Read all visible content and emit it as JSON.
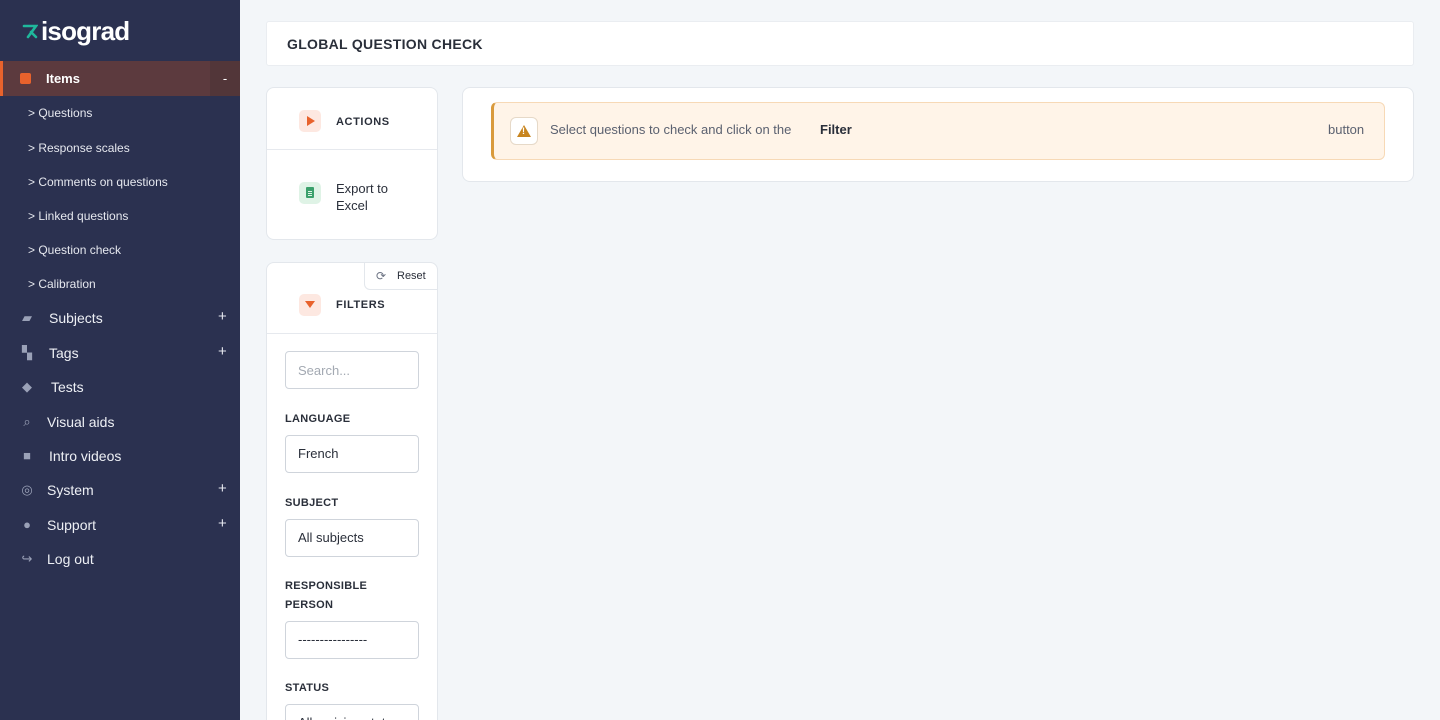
{
  "brand": {
    "name": "isograd",
    "accent": "#e8622c",
    "logo_color": "#1fb89c"
  },
  "sidebar": {
    "active_item": {
      "label": "Items",
      "icon": "pencil-square-icon",
      "toggle": "-"
    },
    "sub_items": [
      "> Questions",
      "> Response scales",
      "> Comments on questions",
      "> Linked questions",
      "> Question check",
      "> Calibration"
    ],
    "items": [
      {
        "label": "Subjects",
        "icon": "folder-icon",
        "expand": "+"
      },
      {
        "label": "Tags",
        "icon": "tags-icon",
        "expand": "+"
      },
      {
        "label": "Tests",
        "icon": "graduation-cap-icon",
        "expand": ""
      },
      {
        "label": "Visual aids",
        "icon": "search-icon",
        "expand": ""
      },
      {
        "label": "Intro videos",
        "icon": "video-icon",
        "expand": ""
      },
      {
        "label": "System",
        "icon": "gear-icon",
        "expand": "+"
      },
      {
        "label": "Support",
        "icon": "help-icon",
        "expand": "+"
      },
      {
        "label": "Log out",
        "icon": "logout-icon",
        "expand": ""
      }
    ]
  },
  "header": {
    "title": "GLOBAL QUESTION CHECK"
  },
  "actions": {
    "title": "ACTIONS",
    "export_label": "Export to Excel"
  },
  "filters": {
    "title": "FILTERS",
    "reset_label": "Reset",
    "search_placeholder": "Search...",
    "language_label": "LANGUAGE",
    "language_value": "French",
    "subject_label": "SUBJECT",
    "subject_value": "All subjects",
    "responsible_label": "RESPONSIBLE PERSON",
    "responsible_value": "----------------",
    "status_label": "STATUS",
    "status_value": "All revision statuses"
  },
  "alert": {
    "text": "Select questions to check and click on the",
    "strong": "Filter",
    "end": "button"
  }
}
